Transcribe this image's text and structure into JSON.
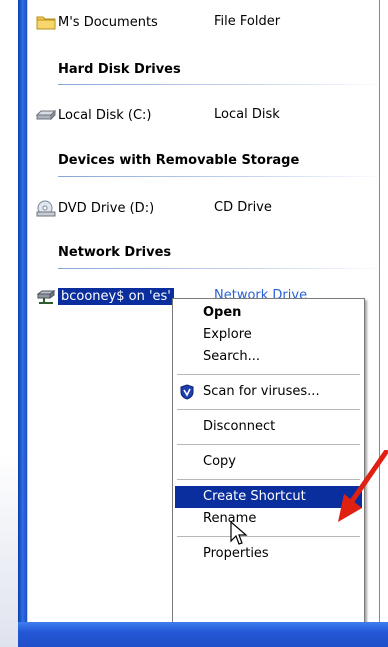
{
  "files": {
    "my_documents": {
      "name": "M's Documents",
      "type": "File Folder"
    },
    "groups": {
      "hard_disk": "Hard Disk Drives",
      "removable": "Devices with Removable Storage",
      "network": "Network Drives"
    },
    "local_disk": {
      "name": "Local Disk (C:)",
      "type": "Local Disk"
    },
    "dvd_drive": {
      "name": "DVD Drive (D:)",
      "type": "CD Drive"
    },
    "network_drive": {
      "name": "bcooney$ on 'es'",
      "type": "Network Drive"
    }
  },
  "context_menu": {
    "open": "Open",
    "explore": "Explore",
    "search": "Search...",
    "scan": "Scan for viruses...",
    "disconnect": "Disconnect",
    "copy": "Copy",
    "create_shortcut": "Create Shortcut",
    "rename": "Rename",
    "properties": "Properties"
  },
  "colors": {
    "selection": "#0a2e9e",
    "taskbar": "#2457d6",
    "annotation_arrow": "#e02010"
  },
  "icons": {
    "folder": "folder-icon",
    "disk": "hard-disk-icon",
    "dvd": "dvd-drive-icon",
    "network": "network-drive-icon",
    "scan": "shield-icon",
    "cursor": "mouse-pointer-icon",
    "arrow": "red-arrow-icon"
  }
}
